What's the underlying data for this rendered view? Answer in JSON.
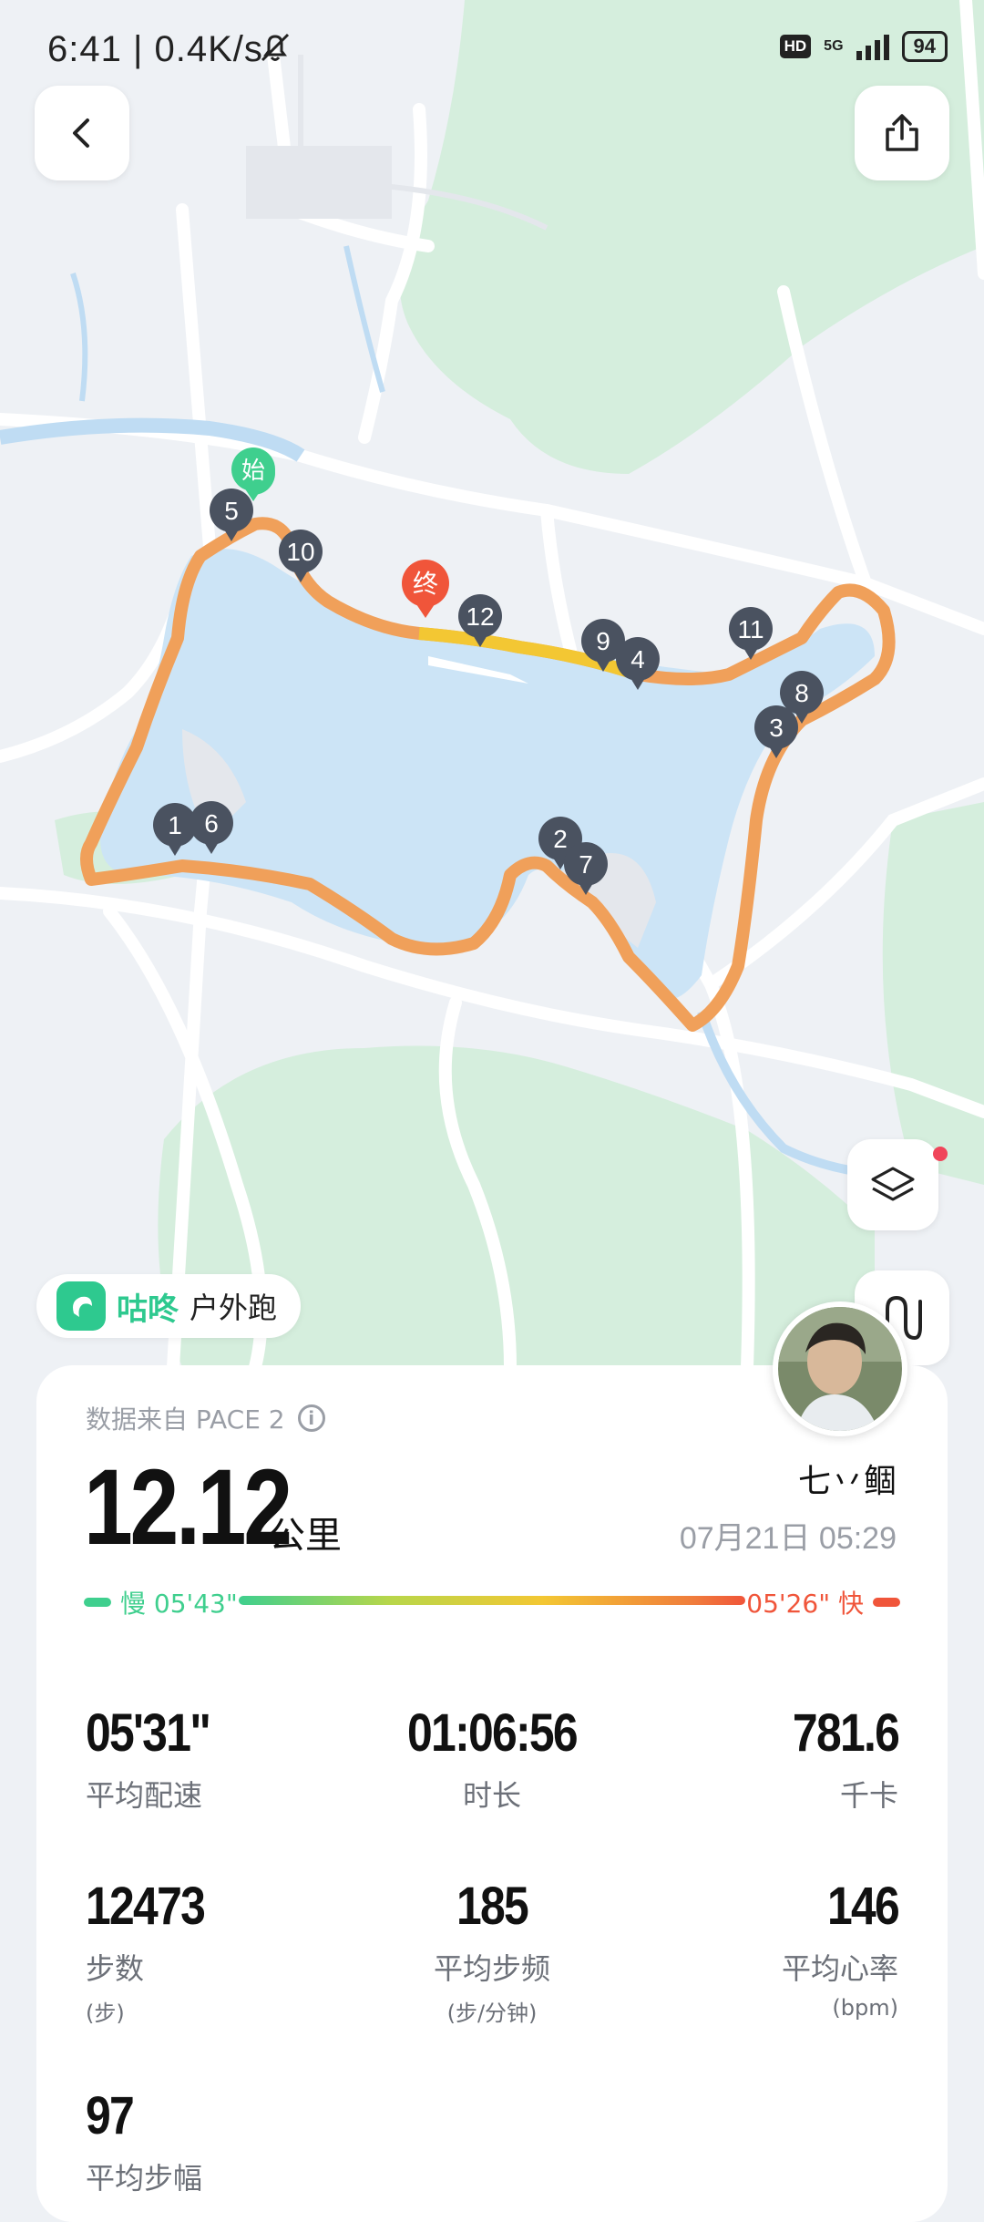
{
  "status_bar": {
    "time_speed": "6:41 | 0.4K/s",
    "hd": "HD",
    "network": "5G",
    "battery": "94"
  },
  "map": {
    "start_label": "始",
    "end_label": "终",
    "km_markers": [
      "1",
      "2",
      "3",
      "4",
      "5",
      "6",
      "7",
      "8",
      "9",
      "10",
      "11",
      "12"
    ]
  },
  "activity": {
    "brand": "咕咚",
    "type": "户外跑"
  },
  "summary": {
    "source": "数据来自 PACE 2",
    "distance": "12.12",
    "distance_unit": "公里",
    "user_name": "七丷鲴",
    "datetime": "07月21日 05:29",
    "pace_slow_label": "慢 05'43\"",
    "pace_fast_label": "05'26\" 快"
  },
  "stats": [
    {
      "value": "05'31\"",
      "label": "平均配速",
      "sub": ""
    },
    {
      "value": "01:06:56",
      "label": "时长",
      "sub": ""
    },
    {
      "value": "781.6",
      "label": "千卡",
      "sub": ""
    },
    {
      "value": "12473",
      "label": "步数",
      "sub": "(步)"
    },
    {
      "value": "185",
      "label": "平均步频",
      "sub": "(步/分钟)"
    },
    {
      "value": "146",
      "label": "平均心率",
      "sub": "(bpm)"
    },
    {
      "value": "97",
      "label": "平均步幅",
      "sub": ""
    }
  ],
  "colors": {
    "route": "#f0a05a",
    "accent_green": "#2ec98f",
    "end_red": "#f0553a",
    "marker_dark": "#4a5260"
  }
}
